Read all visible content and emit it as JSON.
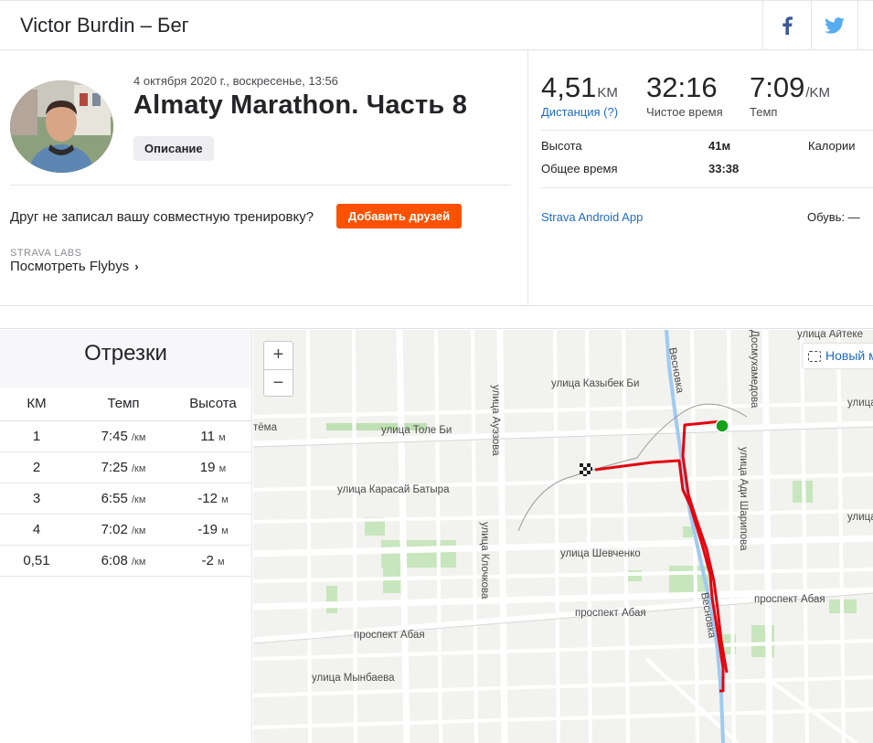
{
  "header": {
    "title": "Victor Burdin – Бег",
    "share_facebook": "facebook-icon",
    "share_twitter": "twitter-icon"
  },
  "activity": {
    "date": "4 октября 2020 г., воскресенье, 13:56",
    "title": "Almaty Marathon. Часть 8",
    "description_button": "Описание",
    "friend_question": "Друг не записал вашу совместную тренировку?",
    "add_friends_button": "Добавить друзей",
    "labs_label": "STRAVA LABS",
    "flybys_link": "Посмотреть Flybys",
    "flybys_chevron": "›"
  },
  "stats": {
    "distance_value": "4,51",
    "distance_unit": "KM",
    "distance_label": "Дистанция (?)",
    "moving_time_value": "32:16",
    "moving_time_label": "Чистое время",
    "pace_value": "7:09",
    "pace_unit": "/KM",
    "pace_label": "Темп",
    "elevation_label": "Высота",
    "elevation_value": "41м",
    "calories_label": "Калории",
    "elapsed_label": "Общее время",
    "elapsed_value": "33:38",
    "device": "Strava Android App",
    "shoes": "Обувь: —"
  },
  "splits": {
    "title": "Отрезки",
    "columns": [
      "КМ",
      "Темп",
      "Высота"
    ],
    "pace_unit": "/км",
    "elev_unit": "м",
    "rows": [
      {
        "km": "1",
        "pace": "7:45",
        "elev": "11"
      },
      {
        "km": "2",
        "pace": "7:25",
        "elev": "19"
      },
      {
        "km": "3",
        "pace": "6:55",
        "elev": "-12"
      },
      {
        "km": "4",
        "pace": "7:02",
        "elev": "-19"
      },
      {
        "km": "0,51",
        "pace": "6:08",
        "elev": "-2"
      }
    ]
  },
  "map": {
    "zoom_in": "+",
    "zoom_out": "−",
    "new_map_button": "Новый м",
    "streets": {
      "tole_bi": "улица Толе Би",
      "karasai": "улица Карасай Батыра",
      "kazybek": "улица Казыбек Би",
      "auezova": "улица Ауэзова",
      "klochkova": "улица Клочкова",
      "shevchenko": "улица Шевченко",
      "abaya_left": "проспект Абая",
      "abaya_mid": "проспект Абая",
      "abaya_right": "проспект Абая",
      "mynbaeva": "улица Мынбаева",
      "sharipova": "улица Ади Шарипова",
      "dosmukhamedova": "Досмухамедова",
      "aiteke": "улица Айтеке",
      "vesnovka": "Весновка",
      "vesnovka2": "Весновка",
      "tyoma": "тёма",
      "ulica_right": "улица"
    },
    "route_color": "#e3040f",
    "start_color": "#16a01b"
  },
  "colors": {
    "accent": "#fc5200",
    "link": "#1e6bc6"
  }
}
